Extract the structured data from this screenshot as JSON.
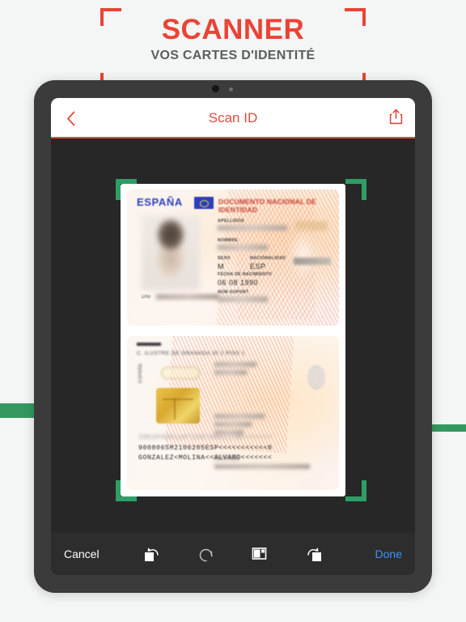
{
  "promo": {
    "title": "SCANNER",
    "subtitle": "VOS CARTES D'IDENTITÉ",
    "title_color": "#ea4335",
    "subtitle_color": "#5d5d5d",
    "bracket_color": "#ea4335"
  },
  "accents": {
    "green": "#33995f",
    "crop_green": "#2e9e66"
  },
  "navbar": {
    "title": "Scan ID",
    "title_color": "#e04a3f",
    "back_icon": "chevron-left-icon",
    "share_icon": "share-icon",
    "underline_color": "#e04a3f"
  },
  "toolbar": {
    "cancel_label": "Cancel",
    "done_label": "Done",
    "done_color": "#3e93f7",
    "icons": [
      {
        "name": "rotate-left-icon"
      },
      {
        "name": "undo-icon"
      },
      {
        "name": "crop-icon"
      },
      {
        "name": "rotate-right-icon"
      }
    ]
  },
  "document": {
    "page_color": "#ffffff",
    "card_front": {
      "country": "ESPAÑA",
      "doc_title": "DOCUMENTO NACIONAL DE IDENTIDAD",
      "dni_label": "DNI",
      "fields": [
        {
          "label": "APELLIDOS",
          "value": ""
        },
        {
          "label": "NOMBRE",
          "value": ""
        },
        {
          "label": "SEXO",
          "value": "M"
        },
        {
          "label": "NACIONALIDAD",
          "value": "ESP"
        },
        {
          "label": "FECHA DE NACIMIENTO",
          "value": "06 08 1990"
        },
        {
          "label": "NÚM SOPORT",
          "value": ""
        }
      ]
    },
    "card_back": {
      "header_line": "C. ILUSTRE DE GRANADA 30 2 PISO 1",
      "mrz": [
        "IDESP00912072597688117BC<<<<<<",
        "9008065M2106205ESP<<<<<<<<<<<0",
        "GONZALEZ<MOLINA<<ALVARO<<<<<<<"
      ]
    }
  }
}
